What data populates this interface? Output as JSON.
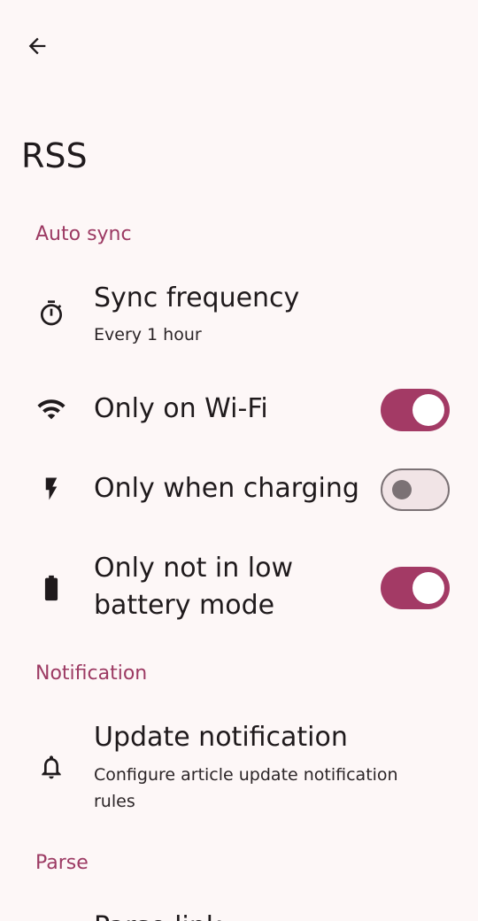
{
  "header": {
    "title": "RSS",
    "back_icon": "arrow-back-icon"
  },
  "sections": {
    "auto_sync": "Auto sync",
    "notification": "Notification",
    "parse": "Parse"
  },
  "settings": {
    "sync_frequency": {
      "title": "Sync frequency",
      "subtitle": "Every 1 hour",
      "icon": "timer-icon"
    },
    "only_wifi": {
      "title": "Only on Wi-Fi",
      "enabled": true,
      "icon": "wifi-icon"
    },
    "only_charging": {
      "title": "Only when charging",
      "enabled": false,
      "icon": "bolt-icon"
    },
    "low_battery": {
      "title_line1": "Only not in low",
      "title_line2": "battery mode",
      "enabled": true,
      "icon": "battery-icon"
    },
    "update_notification": {
      "title": "Update notification",
      "subtitle_line1": "Configure article update notification",
      "subtitle_line2": "rules",
      "icon": "bell-icon"
    },
    "parse_cutoff": {
      "title": "Parse link"
    }
  },
  "colors": {
    "accent": "#a33a65",
    "section": "#9c3a63",
    "background": "#fdf7f7"
  }
}
